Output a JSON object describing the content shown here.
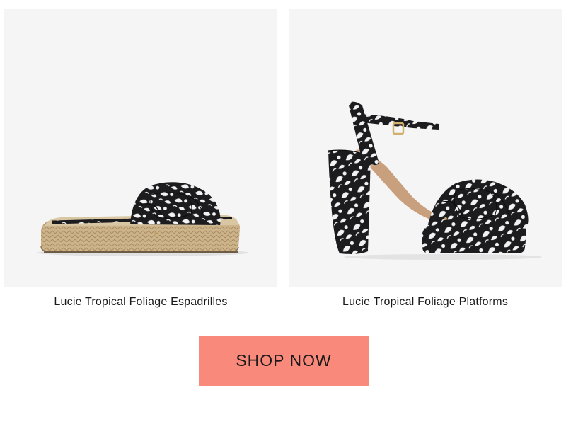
{
  "products": [
    {
      "name": "Lucie Tropical Foliage Espadrilles",
      "image": "espadrille-sandal-image"
    },
    {
      "name": "Lucie Tropical Foliage Platforms",
      "image": "platform-heel-sandal-image"
    }
  ],
  "cta": {
    "label": "SHOP NOW"
  },
  "colors": {
    "button_bg": "#f9897a",
    "card_bg": "#f5f5f5",
    "text": "#1a1a1a",
    "print_dark": "#1c1b1d",
    "print_light": "#f2f2f2",
    "jute": "#cdb48b",
    "strap_tan": "#c9a07d"
  }
}
